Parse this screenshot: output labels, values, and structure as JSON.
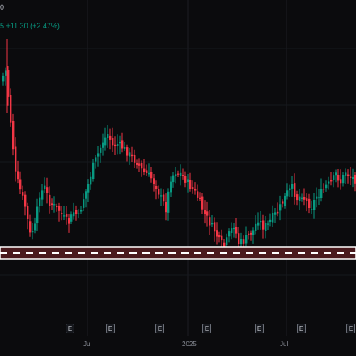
{
  "header": {
    "top_fragment": "0",
    "change_fragment": "5  +11.30 (+2.47%)"
  },
  "colors": {
    "up": "#089981",
    "down": "#f23645",
    "zone_border": "#ffffff",
    "zone_fill": "#4a1a1d",
    "background": "#0b0b0d"
  },
  "earnings_markers": [
    {
      "label": "E"
    },
    {
      "label": "E"
    },
    {
      "label": "E"
    },
    {
      "label": "E"
    },
    {
      "label": "E"
    },
    {
      "label": "E"
    },
    {
      "label": "E"
    }
  ],
  "time_axis": {
    "ticks": [
      "Jul",
      "2025",
      "Jul"
    ]
  },
  "chart_data": {
    "type": "candlestick",
    "x_tick_labels": [
      "Jul",
      "2025",
      "Jul"
    ],
    "support_zone": {
      "style": "dashed band with white border"
    }
  }
}
